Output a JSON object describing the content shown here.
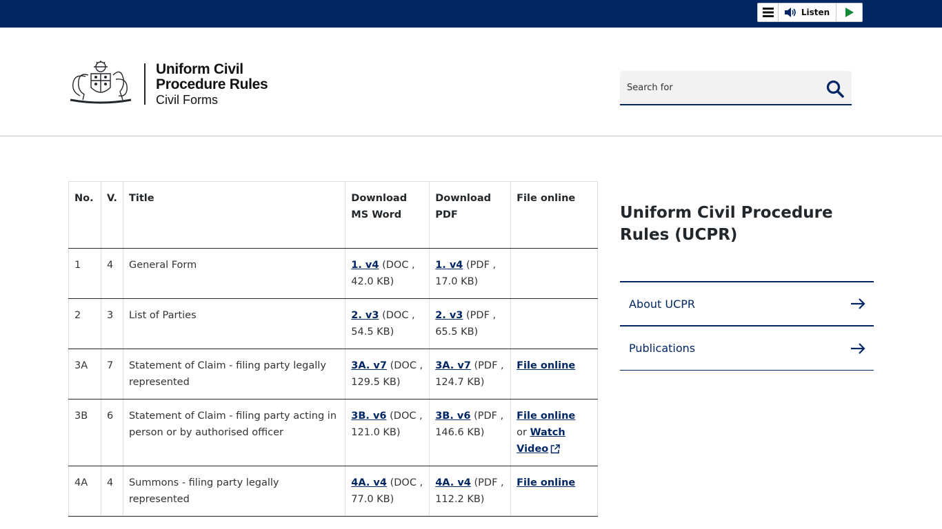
{
  "topbar": {
    "listen_label": "Listen",
    "icons": [
      "menu-icon",
      "speaker-icon",
      "play-icon"
    ],
    "color": "#002664"
  },
  "header": {
    "logo_line1": "Uniform Civil",
    "logo_line2": "Procedure Rules",
    "logo_sub": "Civil Forms"
  },
  "search": {
    "placeholder": "Search for",
    "value": ""
  },
  "table": {
    "headers": [
      "No.",
      "V.",
      "Title",
      "Download MS Word",
      "Download PDF",
      "File online"
    ],
    "rows": [
      {
        "no": "1",
        "v": "4",
        "title": "General Form",
        "doc_link": "1. v4",
        "doc_meta": "(DOC , 42.0 KB)",
        "pdf_link": "1. v4",
        "pdf_meta": "(PDF , 17.0 KB)"
      },
      {
        "no": "2",
        "v": "3",
        "title": "List of Parties",
        "doc_link": "2. v3",
        "doc_meta": "(DOC , 54.5 KB)",
        "pdf_link": "2. v3",
        "pdf_meta": "(PDF , 65.5 KB)"
      },
      {
        "no": "3A",
        "v": "7",
        "title": "Statement of Claim - filing party legally represented",
        "doc_link": "3A. v7",
        "doc_meta": "(DOC , 129.5 KB)",
        "pdf_link": "3A. v7",
        "pdf_meta": "(PDF , 124.7 KB)",
        "file_online": "File online"
      },
      {
        "no": "3B",
        "v": "6",
        "title": "Statement of Claim - filing party acting in person or by authorised officer",
        "doc_link": "3B. v6",
        "doc_meta": "(DOC , 121.0 KB)",
        "pdf_link": "3B. v6",
        "pdf_meta": "(PDF , 146.6 KB)",
        "file_online": "File online",
        "or": "or",
        "watch": "Watch Video"
      },
      {
        "no": "4A",
        "v": "4",
        "title": "Summons - filing party legally represented",
        "doc_link": "4A. v4",
        "doc_meta": "(DOC , 77.0 KB)",
        "pdf_link": "4A. v4",
        "pdf_meta": "(PDF , 112.2 KB)",
        "file_online": "File online"
      }
    ]
  },
  "sidebar": {
    "title": "Uniform Civil Procedure Rules (UCPR)",
    "items": [
      {
        "label": "About UCPR"
      },
      {
        "label": "Publications"
      }
    ]
  }
}
